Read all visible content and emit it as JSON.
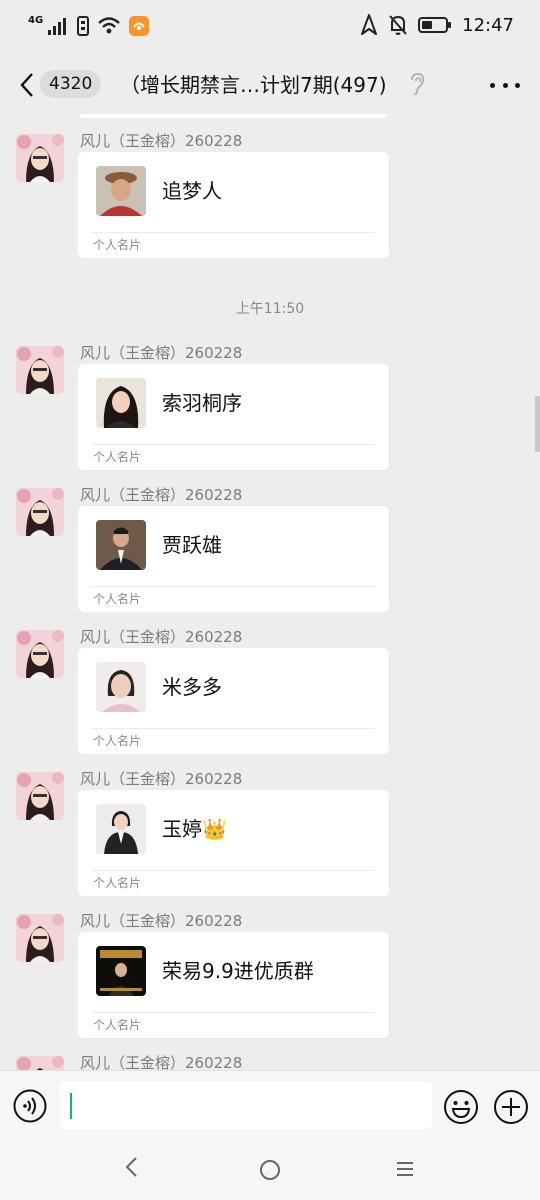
{
  "status_bar": {
    "network": "4G",
    "time": "12:47"
  },
  "header": {
    "back_count": "4320",
    "title": "（增长期禁言…计划7期(497)"
  },
  "chat": {
    "time_divider": "上午11:50",
    "messages": [
      {
        "sender": "风儿（王金榕）260228",
        "card_name": "追梦人",
        "card_type": "个人名片"
      },
      {
        "sender": "风儿（王金榕）260228",
        "card_name": "索羽桐序",
        "card_type": "个人名片"
      },
      {
        "sender": "风儿（王金榕）260228",
        "card_name": "贾跃雄",
        "card_type": "个人名片"
      },
      {
        "sender": "风儿（王金榕）260228",
        "card_name": "米多多",
        "card_type": "个人名片"
      },
      {
        "sender": "风儿（王金榕）260228",
        "card_name": "玉婷👑",
        "card_type": "个人名片"
      },
      {
        "sender": "风儿（王金榕）260228",
        "card_name": "荣易9.9进优质群",
        "card_type": "个人名片"
      },
      {
        "sender": "风儿（王金榕）260228"
      }
    ]
  },
  "input": {
    "value": "",
    "icons": [
      "voice-icon",
      "emoji-icon",
      "plus-icon"
    ]
  },
  "system_nav": {
    "icons": [
      "back-triangle-icon",
      "home-circle-icon",
      "menu-lines-icon"
    ]
  },
  "colors": {
    "background": "#ededed",
    "bubble": "#ffffff",
    "caret": "#07c160",
    "meta_text": "#7c7c7c"
  }
}
